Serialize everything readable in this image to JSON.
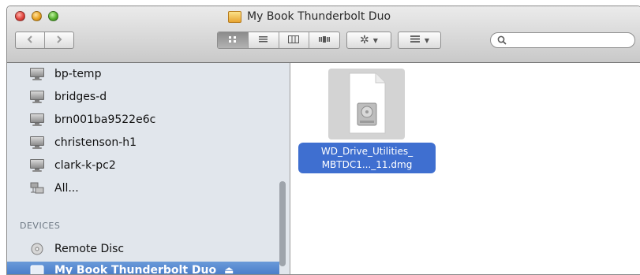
{
  "window": {
    "title": "My Book Thunderbolt Duo"
  },
  "toolbar": {
    "nav_back": "◀",
    "nav_forward": "▶",
    "view_icon": "icon-view",
    "view_list": "list-view",
    "view_columns": "column-view",
    "view_coverflow": "coverflow-view",
    "action_icon": "gear-icon",
    "arrange_icon": "arrange-icon",
    "search_placeholder": ""
  },
  "sidebar": {
    "shared_items": [
      {
        "label": "bp-temp",
        "icon": "computer-icon"
      },
      {
        "label": "bridges-d",
        "icon": "computer-icon"
      },
      {
        "label": "brn001ba9522e6c",
        "icon": "computer-icon"
      },
      {
        "label": "christenson-h1",
        "icon": "computer-icon"
      },
      {
        "label": "clark-k-pc2",
        "icon": "computer-icon"
      },
      {
        "label": "All...",
        "icon": "network-icon"
      }
    ],
    "devices_header": "DEVICES",
    "devices": [
      {
        "label": "Remote Disc",
        "icon": "disc-icon"
      },
      {
        "label": "My Book Thunderbolt Duo",
        "icon": "drive-icon",
        "selected": true,
        "eject": "⏏"
      }
    ]
  },
  "content": {
    "files": [
      {
        "name_line1": "WD_Drive_Utilities_",
        "name_line2": "MBTDC1..._11.dmg",
        "selected": true,
        "icon": "dmg-disk-image-icon"
      }
    ]
  },
  "colors": {
    "sidebar_bg": "#e1e6ec",
    "selection_blue": "#3f6fd0",
    "sidebar_selection": "#4a7fc9"
  }
}
